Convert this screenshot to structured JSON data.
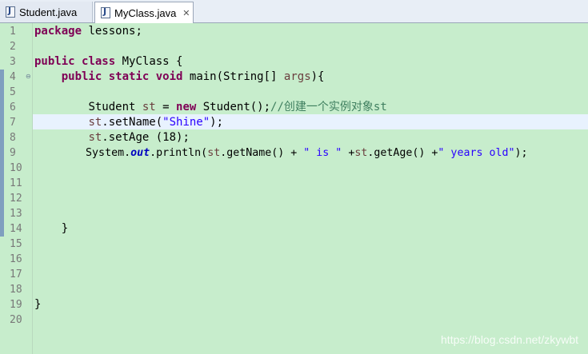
{
  "tabs": [
    {
      "label": "Student.java",
      "active": false,
      "icon": "java-file-icon"
    },
    {
      "label": "MyClass.java",
      "active": true,
      "icon": "java-file-icon",
      "close": "✕"
    }
  ],
  "editor": {
    "background": "#c7edcc",
    "current_line": 7,
    "line_numbers": [
      "1",
      "2",
      "3",
      "4",
      "5",
      "6",
      "7",
      "8",
      "9",
      "10",
      "11",
      "12",
      "13",
      "14",
      "15",
      "16",
      "17",
      "18",
      "19",
      "20"
    ],
    "code": {
      "l1": {
        "kw": "package",
        "rest": " lessons;"
      },
      "l3": {
        "kw1": "public",
        "kw2": "class",
        "rest": " MyClass {"
      },
      "l4": {
        "kw1": "public",
        "kw2": "static",
        "kw3": "void",
        "mid": " main(String[] ",
        "var": "args",
        "end": "){"
      },
      "l6": {
        "pre": "Student ",
        "var": "st",
        "mid": " = ",
        "kw": "new",
        "end": " Student();",
        "comment": "//创建一个实例对象st"
      },
      "l7": {
        "var": "st",
        "pre": ".setName(",
        "str": "\"Shine\"",
        "end": ");"
      },
      "l8": {
        "var": "st",
        "end": ".setAge (18);"
      },
      "l9": {
        "pre": "System.",
        "fld": "out",
        "mid": ".println(",
        "var1": "st",
        "mid2": ".getName() + ",
        "str1": "\" is \"",
        "mid3": " +",
        "var2": "st",
        "mid4": ".getAge() +",
        "str2": "\" years old\"",
        "end": ");"
      },
      "l14": {
        "text": "}"
      },
      "l19": {
        "text": "}"
      }
    }
  },
  "watermark": "https://blog.csdn.net/zkywbt"
}
